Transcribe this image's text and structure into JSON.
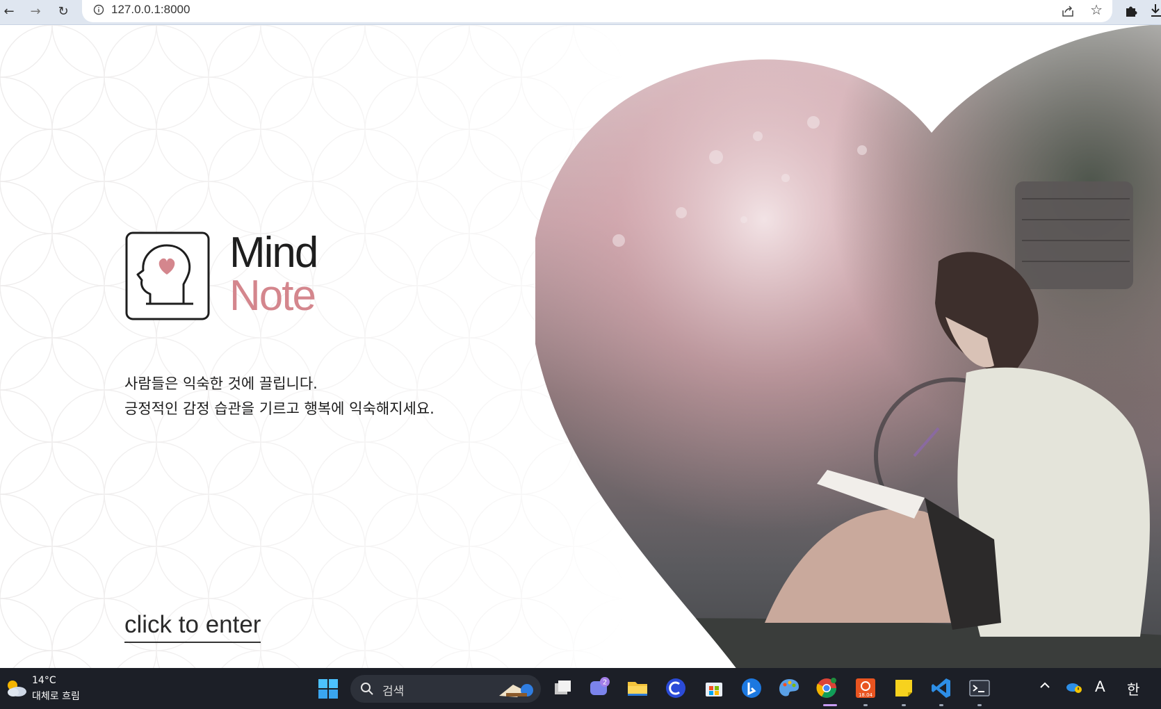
{
  "browser": {
    "url": "127.0.0.1:8000"
  },
  "brand": {
    "word1": "Mind",
    "word2": "Note",
    "accent_color": "#d4868d"
  },
  "tagline": {
    "line1": "사람들은 익숙한 것에 끌립니다.",
    "line2": "긍정적인 감정 습관을 기르고 행복에 익숙해지세요."
  },
  "enter_link": "click to enter",
  "taskbar": {
    "weather_temp": "14°C",
    "weather_desc": "대체로 흐림",
    "search_label": "검색",
    "chat_badge": "2",
    "ubuntu_label": "18.04",
    "ime_mode": "A",
    "ime_lang": "한"
  }
}
